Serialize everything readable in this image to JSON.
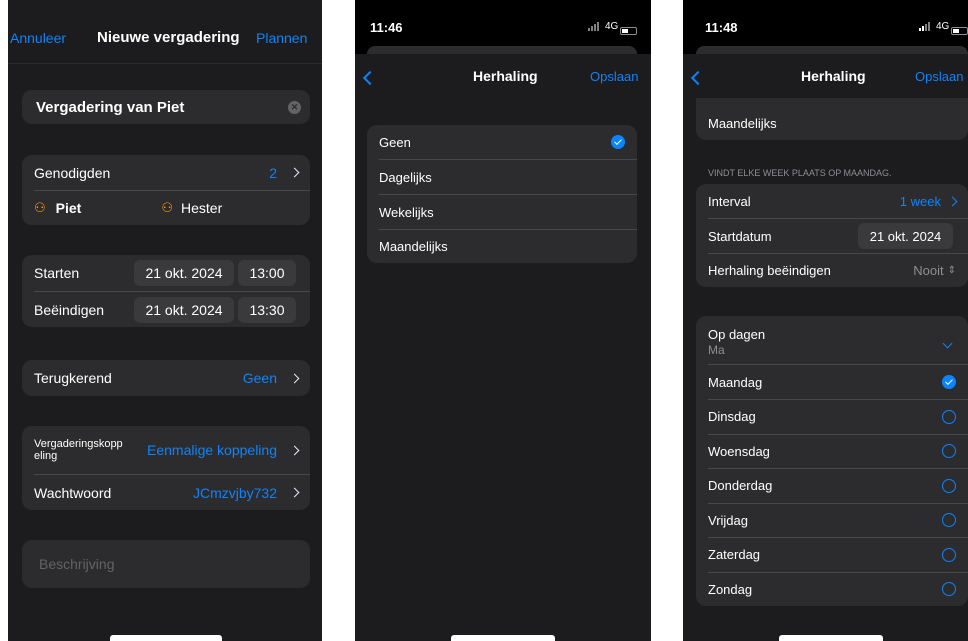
{
  "screen1": {
    "nav": {
      "cancel": "Annuleer",
      "title": "Nieuwe vergadering",
      "schedule": "Plannen"
    },
    "meeting_title": "Vergadering van Piet",
    "invitees": {
      "label": "Genodigden",
      "count": "2",
      "people": [
        "Piet",
        "Hester"
      ]
    },
    "start": {
      "label": "Starten",
      "date": "21 okt. 2024",
      "time": "13:00"
    },
    "end": {
      "label": "Beëindigen",
      "date": "21 okt. 2024",
      "time": "13:30"
    },
    "recurring": {
      "label": "Terugkerend",
      "value": "Geen"
    },
    "meeting_link": {
      "label": "Vergaderingskoppeling",
      "value": "Eenmalige koppeling"
    },
    "password": {
      "label": "Wachtwoord",
      "value": "JCmzvjby732"
    },
    "description_placeholder": "Beschrijving"
  },
  "screen2": {
    "status": {
      "time": "11:46",
      "network": "4G"
    },
    "nav": {
      "title": "Herhaling",
      "save": "Opslaan"
    },
    "options": [
      "Geen",
      "Dagelijks",
      "Wekelijks",
      "Maandelijks"
    ],
    "selected_option": "Geen"
  },
  "screen3": {
    "status": {
      "time": "11:48",
      "network": "4G"
    },
    "nav": {
      "title": "Herhaling",
      "save": "Opslaan"
    },
    "top_item": "Maandelijks",
    "section_header": "VINDT ELKE WEEK PLAATS OP MAANDAG.",
    "interval": {
      "label": "Interval",
      "value": "1 week"
    },
    "start_date": {
      "label": "Startdatum",
      "value": "21 okt. 2024"
    },
    "end_repeat": {
      "label": "Herhaling beëindigen",
      "value": "Nooit"
    },
    "on_days": {
      "label": "Op dagen",
      "value": "Ma"
    },
    "days": [
      "Maandag",
      "Dinsdag",
      "Woensdag",
      "Donderdag",
      "Vrijdag",
      "Zaterdag",
      "Zondag"
    ],
    "selected_days": [
      "Maandag"
    ]
  },
  "colors": {
    "accent": "#0a84ff",
    "background": "#000000",
    "cell": "#2c2c2e",
    "sheet": "#1c1c1e"
  },
  "icons": {
    "person": "person-icon",
    "check": "checkmark-circle-icon",
    "clear": "clear-icon"
  }
}
